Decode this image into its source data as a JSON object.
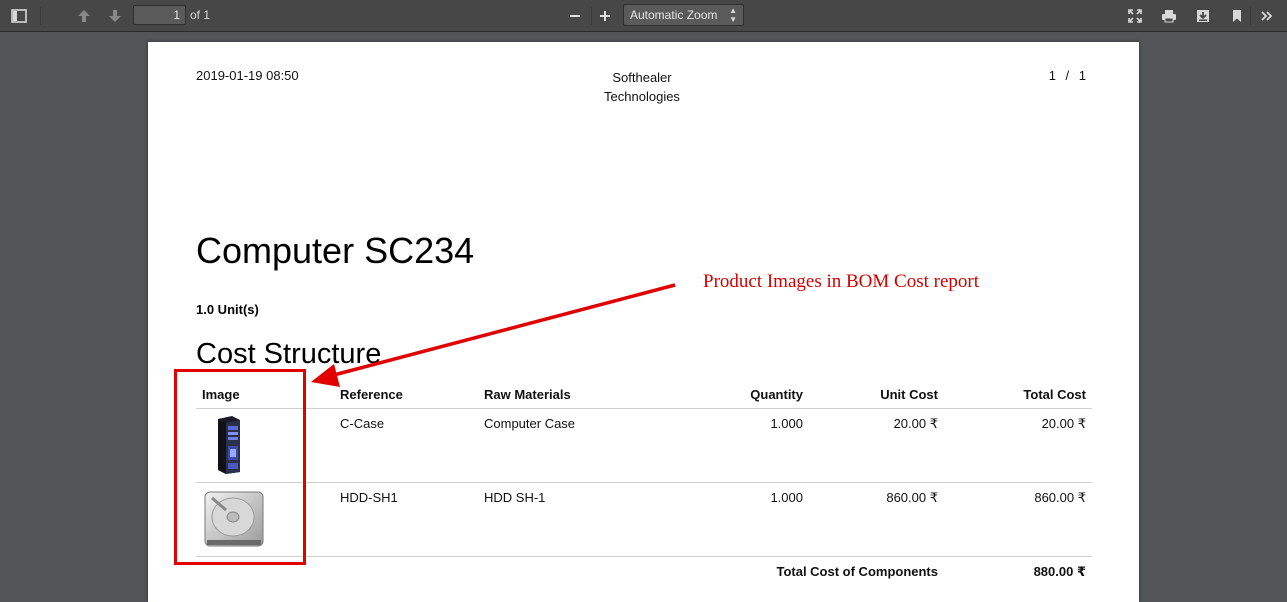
{
  "toolbar": {
    "page_number": "1",
    "page_count_label": "of 1",
    "zoom_label": "Automatic Zoom"
  },
  "report": {
    "date": "2019-01-19 08:50",
    "company_line1": "Softhealer",
    "company_line2": "Technologies",
    "page_indicator": "1 / 1",
    "title": "Computer SC234",
    "quantity": "1.0 Unit(s)",
    "section_title": "Cost Structure",
    "columns": [
      "Image",
      "Reference",
      "Raw Materials",
      "Quantity",
      "Unit Cost",
      "Total Cost"
    ],
    "rows": [
      {
        "image": "computer-case-image",
        "reference": "C-Case",
        "raw_material": "Computer Case",
        "quantity": "1.000",
        "unit_cost": "20.00 ₹",
        "total_cost": "20.00 ₹"
      },
      {
        "image": "hard-disk-image",
        "reference": "HDD-SH1",
        "raw_material": "HDD SH-1",
        "quantity": "1.000",
        "unit_cost": "860.00 ₹",
        "total_cost": "860.00 ₹"
      }
    ],
    "total_label": "Total Cost of Components",
    "total_value": "880.00 ₹"
  },
  "annotation": {
    "text": "Product Images in BOM Cost report",
    "color": "#e00000"
  },
  "icons": [
    "sidebar-toggle-icon",
    "arrow-up-icon",
    "arrow-down-icon",
    "zoom-out-icon",
    "zoom-in-icon",
    "fullscreen-icon",
    "print-icon",
    "download-icon",
    "bookmark-icon",
    "more-tools-icon"
  ]
}
